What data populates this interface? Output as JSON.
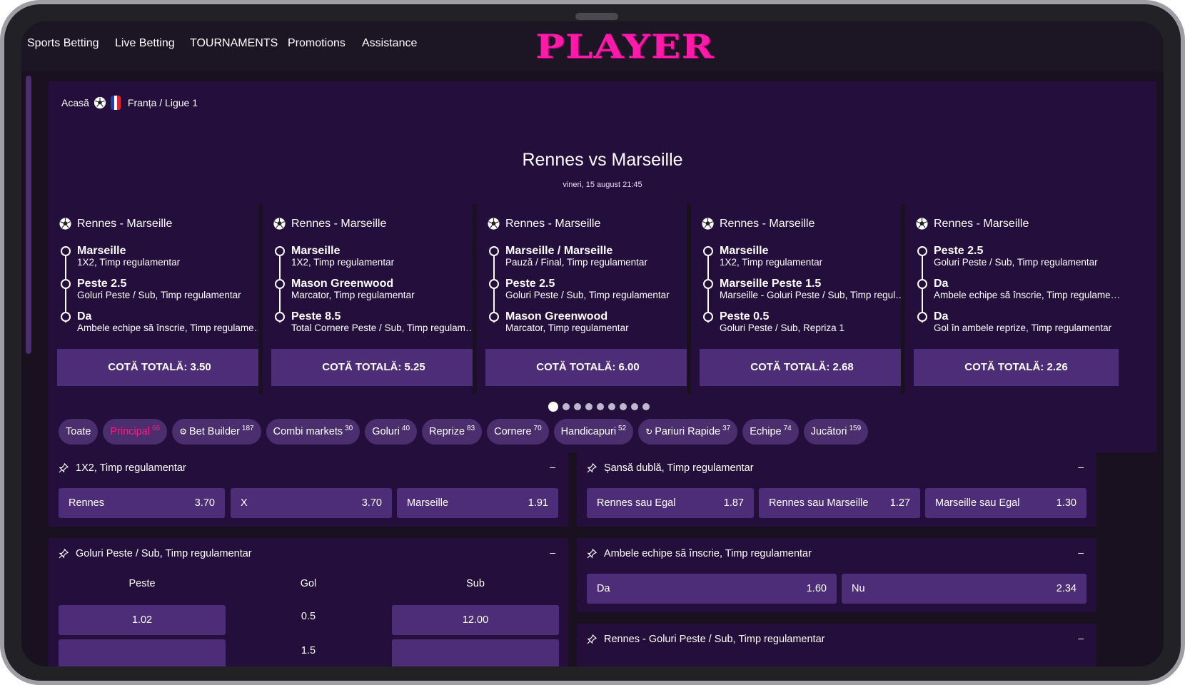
{
  "nav": {
    "items": [
      "Sports Betting",
      "Live Betting",
      "TOURNAMENTS",
      "Promotions",
      "Assistance"
    ],
    "logo_text": "PLAYER"
  },
  "breadcrumb": {
    "home": "Acasă",
    "path": "Franța / Ligue 1"
  },
  "match": {
    "title": "Rennes vs Marseille",
    "date": "vineri, 15 august 21:45"
  },
  "slips": [
    {
      "header": "Rennes - Marseille",
      "selections": [
        {
          "title": "Marseille",
          "sub": "1X2, Timp regulamentar"
        },
        {
          "title": "Peste 2.5",
          "sub": "Goluri Peste / Sub, Timp regulamentar"
        },
        {
          "title": "Da",
          "sub": "Ambele echipe să înscrie, Timp regulamentar"
        }
      ],
      "total": "COTĂ TOTALĂ: 3.50"
    },
    {
      "header": "Rennes - Marseille",
      "selections": [
        {
          "title": "Marseille",
          "sub": "1X2, Timp regulamentar"
        },
        {
          "title": "Mason Greenwood",
          "sub": "Marcator, Timp regulamentar"
        },
        {
          "title": "Peste 8.5",
          "sub": "Total Cornere Peste / Sub, Timp regulamentar"
        }
      ],
      "total": "COTĂ TOTALĂ: 5.25"
    },
    {
      "header": "Rennes - Marseille",
      "selections": [
        {
          "title": "Marseille / Marseille",
          "sub": "Pauză / Final, Timp regulamentar"
        },
        {
          "title": "Peste 2.5",
          "sub": "Goluri Peste / Sub, Timp regulamentar"
        },
        {
          "title": "Mason Greenwood",
          "sub": "Marcator, Timp regulamentar"
        }
      ],
      "total": "COTĂ TOTALĂ: 6.00"
    },
    {
      "header": "Rennes - Marseille",
      "selections": [
        {
          "title": "Marseille",
          "sub": "1X2, Timp regulamentar"
        },
        {
          "title": "Marseille Peste 1.5",
          "sub": "Marseille - Goluri Peste / Sub, Timp regulamentar"
        },
        {
          "title": "Peste 0.5",
          "sub": "Goluri Peste / Sub, Repriza 1"
        }
      ],
      "total": "COTĂ TOTALĂ: 2.68"
    },
    {
      "header": "Rennes - Marseille",
      "selections": [
        {
          "title": "Peste 2.5",
          "sub": "Goluri Peste / Sub, Timp regulamentar"
        },
        {
          "title": "Da",
          "sub": "Ambele echipe să înscrie, Timp regulamentar"
        },
        {
          "title": "Da",
          "sub": "Gol în ambele reprize, Timp regulamentar"
        }
      ],
      "total": "COTĂ TOTALĂ: 2.26"
    }
  ],
  "carousel": {
    "pages": 9,
    "active": 1
  },
  "filters": [
    {
      "label": "Toate",
      "count": "",
      "active": false,
      "icon": ""
    },
    {
      "label": "Principal",
      "count": "66",
      "active": true,
      "icon": ""
    },
    {
      "label": "Bet Builder",
      "count": "187",
      "active": false,
      "icon": "bet-builder-icon"
    },
    {
      "label": "Combi markets",
      "count": "30",
      "active": false,
      "icon": ""
    },
    {
      "label": "Goluri",
      "count": "40",
      "active": false,
      "icon": ""
    },
    {
      "label": "Reprize",
      "count": "83",
      "active": false,
      "icon": ""
    },
    {
      "label": "Cornere",
      "count": "70",
      "active": false,
      "icon": ""
    },
    {
      "label": "Handicapuri",
      "count": "52",
      "active": false,
      "icon": ""
    },
    {
      "label": "Pariuri Rapide",
      "count": "37",
      "active": false,
      "icon": "quick-bet-icon"
    },
    {
      "label": "Echipe",
      "count": "74",
      "active": false,
      "icon": ""
    },
    {
      "label": "Jucători",
      "count": "159",
      "active": false,
      "icon": ""
    }
  ],
  "markets": {
    "m1x2": {
      "title": "1X2, Timp regulamentar",
      "odds": [
        {
          "label": "Rennes",
          "value": "3.70"
        },
        {
          "label": "X",
          "value": "3.70"
        },
        {
          "label": "Marseille",
          "value": "1.91"
        }
      ]
    },
    "double_chance": {
      "title": "Șansă dublă, Timp regulamentar",
      "odds": [
        {
          "label": "Rennes sau Egal",
          "value": "1.87"
        },
        {
          "label": "Rennes sau Marseille",
          "value": "1.27"
        },
        {
          "label": "Marseille sau Egal",
          "value": "1.30"
        }
      ]
    },
    "goals_ou": {
      "title": "Goluri Peste / Sub, Timp regulamentar",
      "col_over": "Peste",
      "col_line": "Gol",
      "col_under": "Sub",
      "rows": [
        {
          "over": "1.02",
          "line": "0.5",
          "under": "12.00"
        },
        {
          "over": "",
          "line": "1.5",
          "under": ""
        }
      ]
    },
    "btts": {
      "title": "Ambele echipe să înscrie, Timp regulamentar",
      "odds": [
        {
          "label": "Da",
          "value": "1.60"
        },
        {
          "label": "Nu",
          "value": "2.34"
        }
      ]
    },
    "rennes_goals": {
      "title": "Rennes - Goluri Peste / Sub, Timp regulamentar"
    }
  },
  "colors": {
    "logo": "#ff1aa8",
    "active_chip": "#ff1a88",
    "panel": "#240f3c",
    "button": "#4d2d77"
  },
  "collapse_symbol": "–"
}
